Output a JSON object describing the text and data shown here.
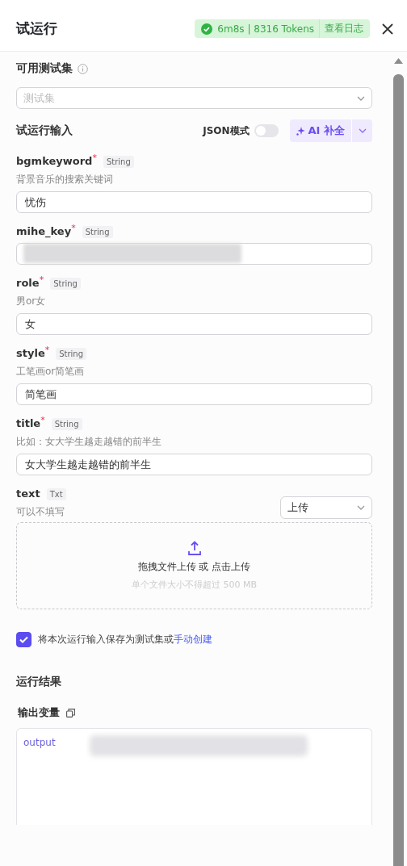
{
  "header": {
    "title": "试运行",
    "status": {
      "ok": true,
      "text": "6m8s | 8316 Tokens",
      "link": "查看日志"
    }
  },
  "test_set": {
    "label": "可用测试集",
    "select": {
      "placeholder": "测试集"
    }
  },
  "run_input": {
    "label": "试运行输入",
    "json_mode": {
      "label": "JSON模式",
      "on": false
    },
    "ai_button": "AI 补全"
  },
  "params": [
    {
      "kind": "text",
      "name": "bgmkeyword",
      "required_mark": "*",
      "type": "String",
      "description": "背景音乐的搜索关键词",
      "value": "忧伤",
      "redacted": false
    },
    {
      "kind": "text",
      "name": "mihe_key",
      "required_mark": "*",
      "type": "String",
      "redacted": true
    },
    {
      "kind": "text",
      "name": "role",
      "required_mark": "*",
      "type": "String",
      "description": "男or女",
      "value": "女",
      "redacted": false
    },
    {
      "kind": "text",
      "name": "style",
      "required_mark": "*",
      "type": "String",
      "description": "工笔画or简笔画",
      "value": "简笔画",
      "redacted": false
    },
    {
      "kind": "text",
      "name": "title",
      "required_mark": "*",
      "type": "String",
      "description": "比如：女大学生越走越错的前半生",
      "value": "女大学生越走越错的前半生",
      "redacted": false
    },
    {
      "kind": "file",
      "name": "text",
      "type": "Txt",
      "description": "可以不填写",
      "mode": "上传",
      "upload_text": "拖拽文件上传 或 点击上传",
      "upload_hint": "单个文件大小不得超过 500 MB"
    }
  ],
  "save": {
    "checked": true,
    "text": "将本次运行输入保存为测试集或",
    "link": "手动创建"
  },
  "result": {
    "title": "运行结果",
    "output_label": "输出变量",
    "output_key": "output",
    "redacted": true
  }
}
